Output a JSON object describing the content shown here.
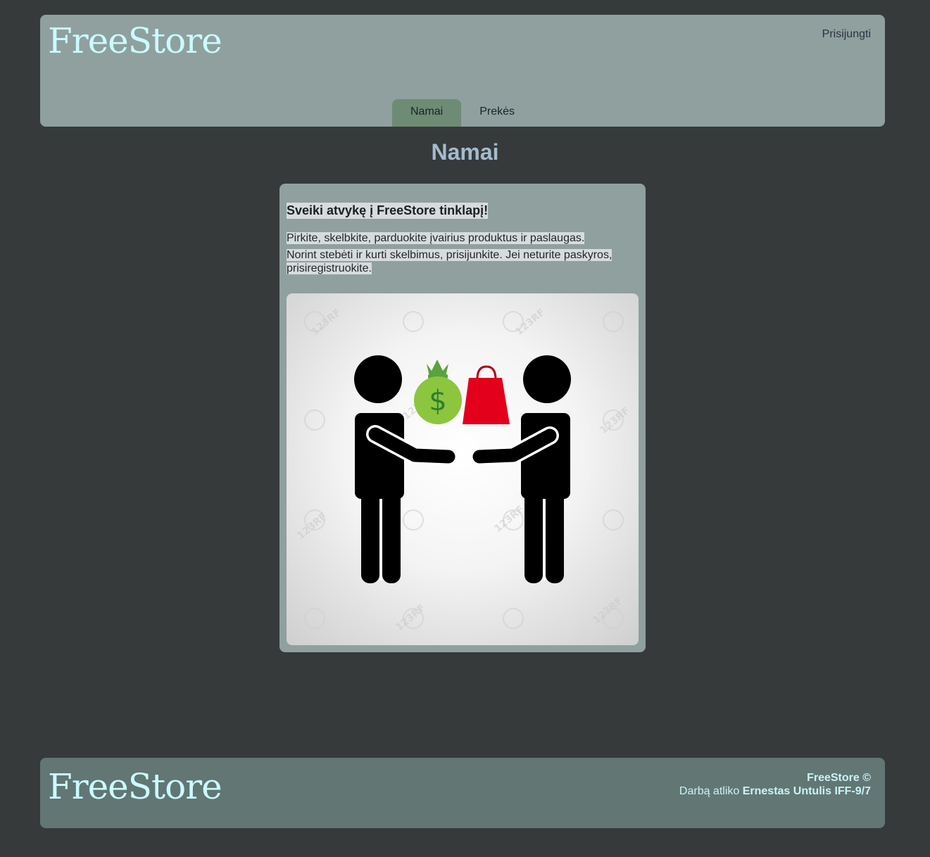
{
  "header": {
    "logo": "FreeStore",
    "login_label": "Prisijungti",
    "nav": [
      {
        "label": "Namai",
        "active": true
      },
      {
        "label": "Prekės",
        "active": false
      }
    ]
  },
  "main": {
    "heading": "Namai",
    "card": {
      "title": "Sveiki atvykę į FreeStore tinklapį!",
      "line1": "Pirkite, skelbkite, parduokite įvairius produktus ir paslaugas.",
      "line2": "Norint stebėti ir kurti skelbimus, prisijunkite. Jei neturite paskyros, prisiregistruokite.",
      "image_watermark": "123RF"
    }
  },
  "footer": {
    "logo": "FreeStore",
    "copyright": "FreeStore ©",
    "credit_prefix": "Darbą atliko",
    "author": "Ernestas Untulis IFF-9/7"
  },
  "colors": {
    "page_bg": "#363a3b",
    "header_bg": "#8fa09f",
    "footer_bg": "#627674",
    "logo": "#c9fbff",
    "active_tab": "#6e8b74",
    "heading": "#a3bccd",
    "money_bag": "#8cc63f",
    "shopping_bag": "#e3001b"
  }
}
